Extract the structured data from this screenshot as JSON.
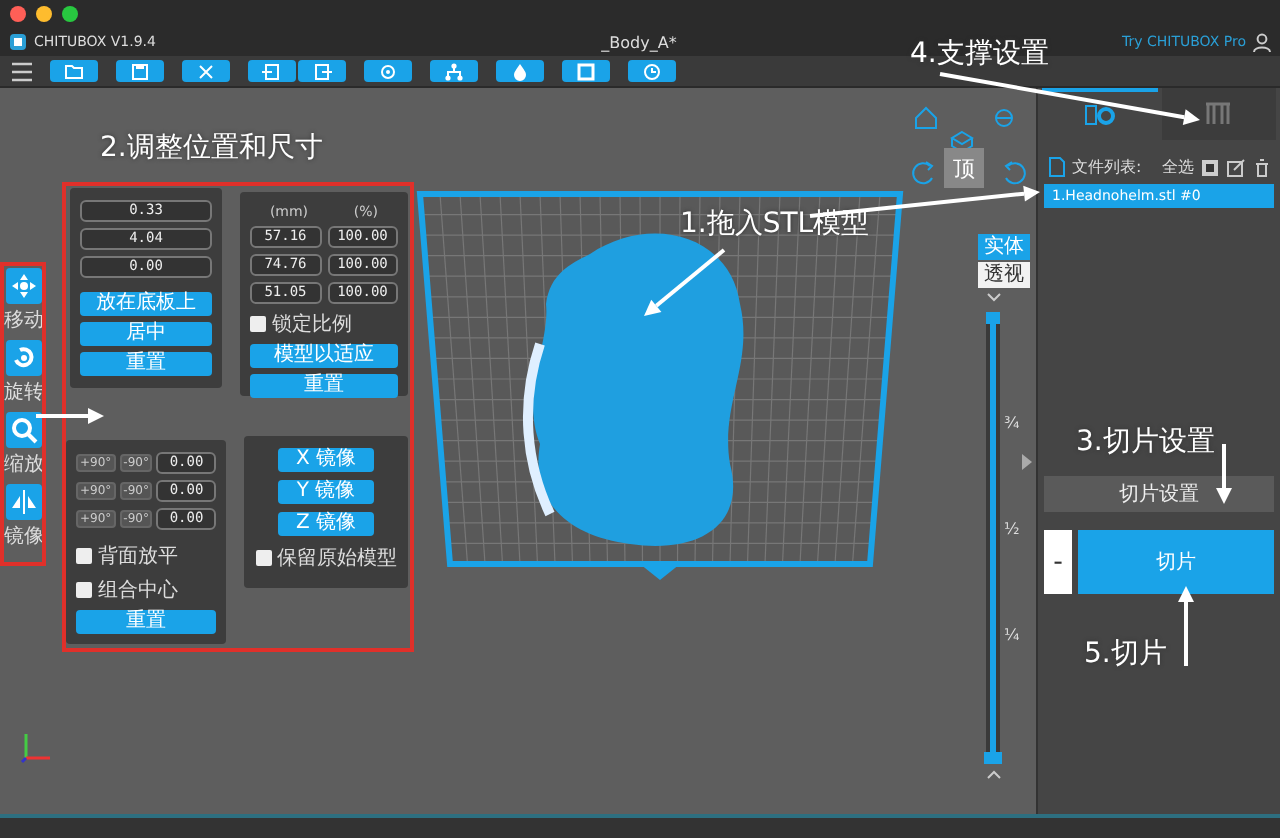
{
  "window": {
    "title": "CHITUBOX V1.9.4",
    "document": "_Body_A*",
    "promo_link": "Try CHITUBOX Pro"
  },
  "left_tools": [
    {
      "kind": "move",
      "label": "移动"
    },
    {
      "kind": "rotate",
      "label": "旋转"
    },
    {
      "kind": "scale",
      "label": "缩放"
    },
    {
      "kind": "mirror",
      "label": "镜像"
    }
  ],
  "move_panel": {
    "fields": [
      "0.33",
      "4.04",
      "0.00"
    ],
    "buttons": [
      "放在底板上",
      "居中",
      "重置"
    ]
  },
  "scale_panel": {
    "headers": [
      "(mm)",
      "(%)"
    ],
    "rows": [
      [
        "57.16",
        "100.00"
      ],
      [
        "74.76",
        "100.00"
      ],
      [
        "51.05",
        "100.00"
      ]
    ],
    "lock_ratio": {
      "label": "锁定比例",
      "checked": false
    },
    "buttons": [
      "模型以适应",
      "重置"
    ]
  },
  "rotate_panel": {
    "rows": [
      {
        "plus": "+90°",
        "minus": "-90°",
        "value": "0.00"
      },
      {
        "plus": "+90°",
        "minus": "-90°",
        "value": "0.00"
      },
      {
        "plus": "+90°",
        "minus": "-90°",
        "value": "0.00"
      }
    ],
    "options": [
      {
        "label": "背面放平",
        "checked": false
      },
      {
        "label": "组合中心",
        "checked": false
      }
    ],
    "button": "重置"
  },
  "mirror_panel": {
    "buttons": [
      "X 镜像",
      "Y 镜像",
      "Z 镜像"
    ],
    "keep_original": {
      "label": "保留原始模型",
      "checked": false
    }
  },
  "view": {
    "top_button": "顶",
    "render_modes": [
      {
        "label": "实体",
        "selected": true
      },
      {
        "label": "透视",
        "selected": false
      }
    ]
  },
  "layer_slider": {
    "level": 1,
    "marks": [
      "¾",
      "½",
      "¼"
    ]
  },
  "side_panel": {
    "tabs": [
      {
        "kind": "model",
        "selected": true
      },
      {
        "kind": "support",
        "selected": false
      }
    ],
    "file_list": {
      "label": "文件列表:",
      "select_all": "全选",
      "files": [
        {
          "name": "1.Headnohelm.stl #0",
          "selected": true
        }
      ]
    },
    "slice_settings_button": "切片设置",
    "minus_button": "-",
    "slice_button": "切片"
  },
  "annotations": [
    {
      "kind": "drag",
      "text": "1.拖入STL模型"
    },
    {
      "kind": "adjust",
      "text": "2.调整位置和尺寸"
    },
    {
      "kind": "settings",
      "text": "3.切片设置"
    },
    {
      "kind": "support",
      "text": "4.支撑设置"
    },
    {
      "kind": "slice",
      "text": "5.切片"
    }
  ]
}
